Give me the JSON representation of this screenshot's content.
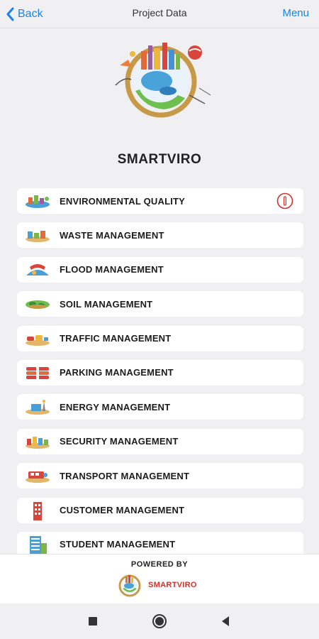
{
  "navbar": {
    "back_label": "Back",
    "title": "Project Data",
    "menu_label": "Menu"
  },
  "app": {
    "title": "SMARTVIRO"
  },
  "menu_items": [
    {
      "label": "ENVIRONMENTAL QUALITY",
      "icon": "environment-icon",
      "alert": true
    },
    {
      "label": "WASTE MANAGEMENT",
      "icon": "waste-icon"
    },
    {
      "label": "FLOOD MANAGEMENT",
      "icon": "flood-icon"
    },
    {
      "label": "SOIL MANAGEMENT",
      "icon": "soil-icon"
    },
    {
      "label": "TRAFFIC MANAGEMENT",
      "icon": "traffic-icon"
    },
    {
      "label": "PARKING MANAGEMENT",
      "icon": "parking-icon"
    },
    {
      "label": "ENERGY MANAGEMENT",
      "icon": "energy-icon"
    },
    {
      "label": "SECURITY MANAGEMENT",
      "icon": "security-icon"
    },
    {
      "label": "TRANSPORT MANAGEMENT",
      "icon": "transport-icon"
    },
    {
      "label": "CUSTOMER MANAGEMENT",
      "icon": "customer-icon"
    },
    {
      "label": "STUDENT MANAGEMENT",
      "icon": "student-icon"
    }
  ],
  "footer": {
    "powered_by": "POWERED BY",
    "brand": "SMARTVIRO"
  },
  "colors": {
    "accent": "#1a84e6",
    "alert": "#d0342c",
    "background": "#f0f0f2"
  }
}
